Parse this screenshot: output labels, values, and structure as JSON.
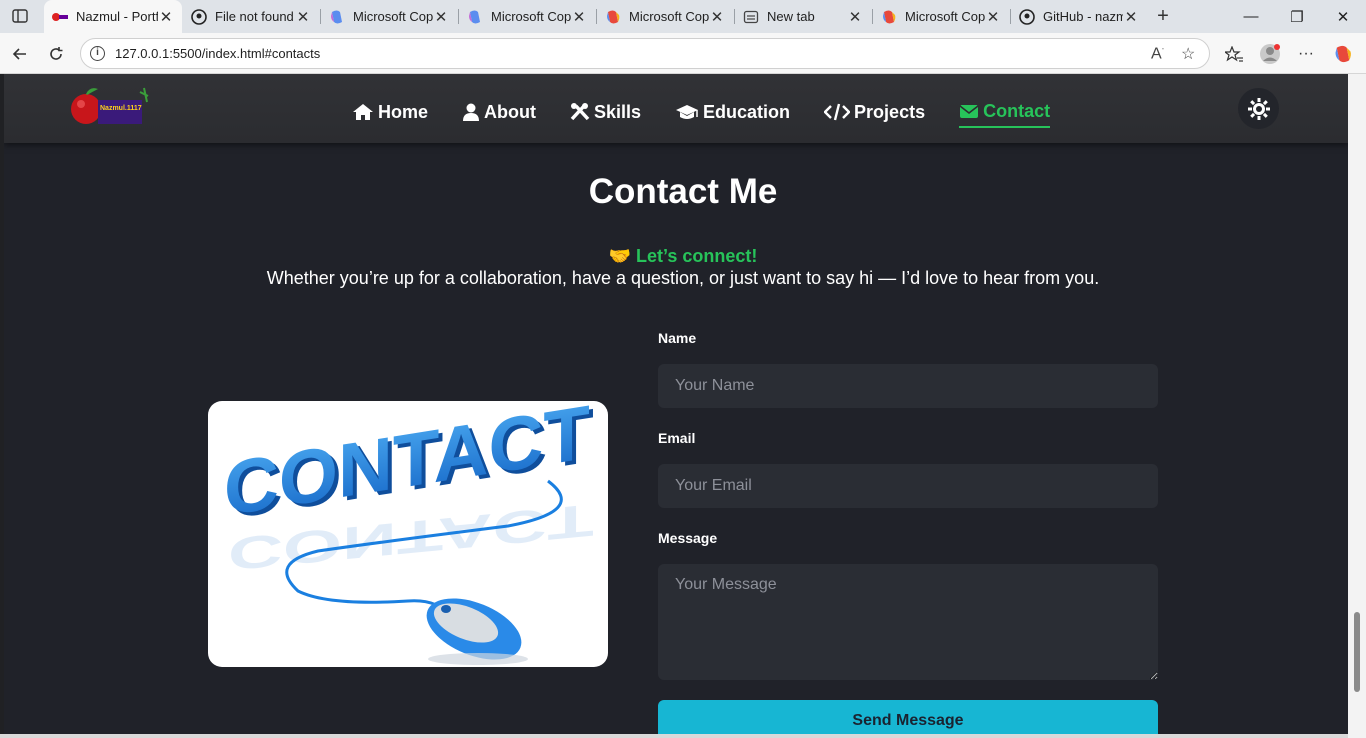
{
  "browser": {
    "tabs": [
      {
        "title": "Nazmul - Portfolio",
        "icon": "nazmul-favicon-icon",
        "active": true
      },
      {
        "title": "File not found",
        "icon": "github-icon"
      },
      {
        "title": "Microsoft Copilot",
        "icon": "copilot-icon"
      },
      {
        "title": "Microsoft Copilot",
        "icon": "copilot-icon"
      },
      {
        "title": "Microsoft Copilot",
        "icon": "copilot-icon"
      },
      {
        "title": "New tab",
        "icon": "new-tab-page-icon"
      },
      {
        "title": "Microsoft Copilot",
        "icon": "copilot-icon"
      },
      {
        "title": "GitHub - nazmul",
        "icon": "github-icon"
      }
    ],
    "url": "127.0.0.1:5500/index.html#contacts"
  },
  "site": {
    "logo_text": "Nazmul.1117",
    "nav": [
      {
        "label": "Home",
        "icon": "home-icon"
      },
      {
        "label": "About",
        "icon": "user-icon"
      },
      {
        "label": "Skills",
        "icon": "tools-icon"
      },
      {
        "label": "Education",
        "icon": "graduation-cap-icon"
      },
      {
        "label": "Projects",
        "icon": "code-icon"
      },
      {
        "label": "Contact",
        "icon": "envelope-icon",
        "active": true
      }
    ],
    "theme_toggle_icon": "sun-icon"
  },
  "contact": {
    "title": "Contact Me",
    "connect_emoji": "🤝",
    "connect_text": "Let’s connect!",
    "intro": "Whether you’re up for a collaboration, have a question, or just want to say hi — I’d love to hear from you.",
    "image_text": "CONTACT",
    "form": {
      "name_label": "Name",
      "name_placeholder": "Your Name",
      "email_label": "Email",
      "email_placeholder": "Your Email",
      "message_label": "Message",
      "message_placeholder": "Your Message",
      "submit_label": "Send Message"
    }
  },
  "colors": {
    "accent_green": "#27c35a",
    "button_cyan": "#17b6d3",
    "page_bg": "#202229"
  }
}
